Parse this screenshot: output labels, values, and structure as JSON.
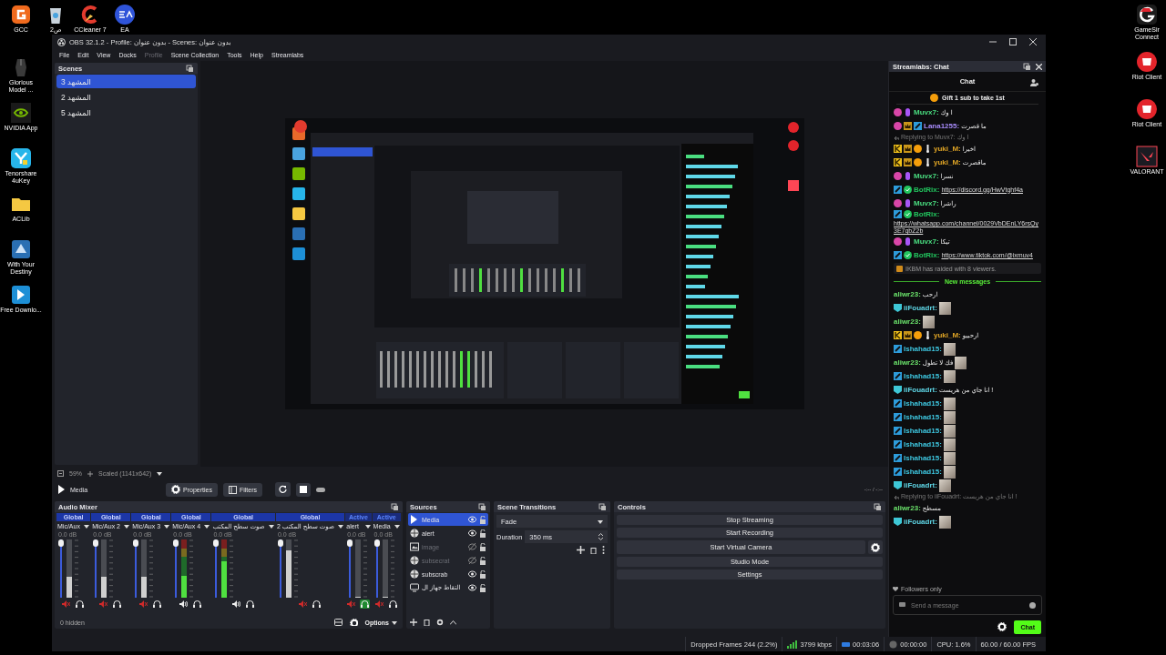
{
  "desktop": {
    "top_row": [
      {
        "label": "GCC",
        "kind": "gcc"
      },
      {
        "label": "2ص",
        "kind": "bin"
      },
      {
        "label": "CCleaner 7",
        "kind": "ccleaner"
      },
      {
        "label": "EA",
        "kind": "ea"
      }
    ],
    "left_column": [
      {
        "label": "Glorious Model ...",
        "kind": "mouse"
      },
      {
        "label": "NVIDIA App",
        "kind": "nvidia"
      },
      {
        "label": "Tenorshare 4uKey",
        "kind": "tenorshare"
      },
      {
        "label": "ACLib",
        "kind": "folder"
      },
      {
        "label": "With Your Destiny",
        "kind": "game"
      },
      {
        "label": "Free Downlo...",
        "kind": "free"
      }
    ],
    "right_column": [
      {
        "label": "GameSir Connect",
        "kind": "gamesir"
      },
      {
        "label": "Riot Client",
        "kind": "riot"
      },
      {
        "label": "Riot Client",
        "kind": "riot"
      },
      {
        "label": "VALORANT",
        "kind": "valorant"
      }
    ]
  },
  "window": {
    "title": "OBS 32.1.2 - Profile: بدون عنوان - Scenes: بدون عنوان",
    "menu": [
      {
        "label": "File",
        "disabled": false
      },
      {
        "label": "Edit",
        "disabled": false
      },
      {
        "label": "View",
        "disabled": false
      },
      {
        "label": "Docks",
        "disabled": false
      },
      {
        "label": "Profile",
        "disabled": true
      },
      {
        "label": "Scene Collection",
        "disabled": false
      },
      {
        "label": "Tools",
        "disabled": false
      },
      {
        "label": "Help",
        "disabled": false
      },
      {
        "label": "Streamlabs",
        "disabled": false
      }
    ]
  },
  "scenes": {
    "title": "Scenes",
    "items": [
      {
        "label": "المشهد 3",
        "selected": true
      },
      {
        "label": "المشهد 2",
        "selected": false
      },
      {
        "label": "المشهد 5",
        "selected": false
      }
    ]
  },
  "preview_toolbar": {
    "zoom": "59%",
    "scale": "Scaled (1141x642)"
  },
  "media_bar": {
    "source": "Media",
    "properties": "Properties",
    "filters": "Filters",
    "time": "-:-- / -:--"
  },
  "audio_mixer": {
    "title": "Audio Mixer",
    "hidden": "0 hidden",
    "options": "Options",
    "channels": [
      {
        "mode": "Global",
        "name": "Mic/Aux",
        "reading": "0.0 dB",
        "fader": {
          "level": 1
        },
        "meter": {
          "level": 0.36
        },
        "muted": true,
        "monitor": false
      },
      {
        "mode": "Global",
        "name": "Mic/Aux 2",
        "reading": "0.0 dB",
        "fader": {
          "level": 1
        },
        "meter": {
          "level": 0.36
        },
        "muted": true,
        "monitor": false
      },
      {
        "mode": "Global",
        "name": "Mic/Aux 3",
        "reading": "0.0 dB",
        "fader": {
          "level": 1
        },
        "meter": {
          "level": 0.36
        },
        "muted": true,
        "monitor": false
      },
      {
        "mode": "Global",
        "name": "Mic/Aux 4",
        "reading": "0.0 dB",
        "fader": {
          "level": 1
        },
        "meter": {
          "level": 0.38
        },
        "muted": false,
        "monitor": false
      },
      {
        "mode": "Global",
        "name": "صوت سطح المكتب",
        "reading": "0.0 dB",
        "fader": {
          "level": 1
        },
        "meter": {
          "level": 0.62
        },
        "muted": false,
        "monitor": false
      },
      {
        "mode": "Global",
        "name": "صوت سطح المكتب 2",
        "reading": "0.0 dB",
        "fader": {
          "level": 1
        },
        "meter": {
          "level": 0.82
        },
        "muted": true,
        "monitor": false
      },
      {
        "mode": "Active",
        "name": "alert",
        "reading": "0.0 dB",
        "fader": {
          "level": 1
        },
        "meter": {
          "level": 0
        },
        "muted": true,
        "monitor": true
      },
      {
        "mode": "Active",
        "name": "Media",
        "reading": "0.0 dB",
        "fader": {
          "level": 1
        },
        "meter": {
          "level": 0
        },
        "muted": true,
        "monitor": false
      }
    ]
  },
  "sources": {
    "title": "Sources",
    "items": [
      {
        "label": "Media",
        "kind": "media",
        "selected": true,
        "visible": true
      },
      {
        "label": "alert",
        "kind": "browser",
        "selected": false,
        "visible": true
      },
      {
        "label": "image",
        "kind": "image",
        "selected": false,
        "visible": false
      },
      {
        "label": "subsecrat",
        "kind": "browser",
        "selected": false,
        "visible": false
      },
      {
        "label": "subscrab",
        "kind": "browser",
        "selected": false,
        "visible": true
      },
      {
        "label": "التقاط جهاز ال",
        "kind": "display",
        "selected": false,
        "visible": true
      }
    ]
  },
  "scene_transitions": {
    "title": "Scene Transitions",
    "transition": "Fade",
    "duration_label": "Duration",
    "duration": "350 ms"
  },
  "controls": {
    "title": "Controls",
    "buttons": [
      {
        "label": "Stop Streaming",
        "kind": "plain"
      },
      {
        "label": "Start Recording",
        "kind": "plain"
      },
      {
        "label": "Start Virtual Camera",
        "kind": "with_settings"
      },
      {
        "label": "Studio Mode",
        "kind": "plain"
      },
      {
        "label": "Settings",
        "kind": "plain"
      }
    ]
  },
  "chat": {
    "dock_title": "Streamlabs: Chat",
    "title": "Chat",
    "pinned": "Gift 1 sub to take 1st",
    "messages": [
      {
        "kind": "message",
        "badges": [
          {
            "kind": "sub"
          },
          {
            "kind": "mic"
          }
        ],
        "user": "Muvx7:",
        "color": "#4ade80",
        "text": "ا وك"
      },
      {
        "kind": "message",
        "badges": [
          {
            "kind": "sub"
          },
          {
            "kind": "crown"
          },
          {
            "kind": "mod"
          }
        ],
        "user": "Lana1255:",
        "color": "#a78bfa",
        "text": "ما قصرت"
      },
      {
        "kind": "reply",
        "text": "Replying to Muvx7: ا وك"
      },
      {
        "kind": "message",
        "badges": [
          {
            "kind": "k"
          },
          {
            "kind": "crown"
          },
          {
            "kind": "coin"
          },
          {
            "kind": "drop"
          }
        ],
        "user": "yuki_M:",
        "color": "#e0a526",
        "text": "اخيرا"
      },
      {
        "kind": "message",
        "badges": [
          {
            "kind": "k"
          },
          {
            "kind": "crown"
          },
          {
            "kind": "coin"
          },
          {
            "kind": "drop"
          }
        ],
        "user": "yuki_M:",
        "color": "#e0a526",
        "text": "ماقصرت"
      },
      {
        "kind": "message",
        "badges": [
          {
            "kind": "sub"
          },
          {
            "kind": "mic"
          }
        ],
        "user": "Muvx7:",
        "color": "#4ade80",
        "text": "نسرا"
      },
      {
        "kind": "message",
        "badges": [
          {
            "kind": "mod"
          },
          {
            "kind": "verified"
          }
        ],
        "user": "BotRix:",
        "color": "#22c55e",
        "text": "https://discord.gg/HwVtghf4a",
        "link": true
      },
      {
        "kind": "message",
        "badges": [
          {
            "kind": "sub"
          },
          {
            "kind": "mic"
          }
        ],
        "user": "Muvx7:",
        "color": "#4ade80",
        "text": "راشرا"
      },
      {
        "kind": "message",
        "badges": [
          {
            "kind": "mod"
          },
          {
            "kind": "verified"
          }
        ],
        "user": "BotRix:",
        "color": "#22c55e",
        "text": "https://whatsapp.com/channel/0029VbDEnLY6rsQy3E7qbZ2b",
        "link": true
      },
      {
        "kind": "message",
        "badges": [
          {
            "kind": "sub"
          },
          {
            "kind": "mic"
          }
        ],
        "user": "Muvx7:",
        "color": "#4ade80",
        "text": "تيكا"
      },
      {
        "kind": "message",
        "badges": [
          {
            "kind": "mod"
          },
          {
            "kind": "verified"
          }
        ],
        "user": "BotRix:",
        "color": "#22c55e",
        "text": "https://www.tiktok.com/@ixmuv4",
        "link": true
      },
      {
        "kind": "raid",
        "text": "IKBM has raided with 8 viewers."
      },
      {
        "kind": "divider",
        "text": "New messages"
      },
      {
        "kind": "message",
        "user": "aliwr23:",
        "color": "#6be36b",
        "text": "ارحب"
      },
      {
        "kind": "message",
        "badges": [
          {
            "kind": "tier"
          }
        ],
        "user": "iiFouadrt:",
        "color": "#5fd8e8",
        "emote": true
      },
      {
        "kind": "message",
        "user": "aliwr23:",
        "color": "#6be36b",
        "emote": true
      },
      {
        "kind": "message",
        "badges": [
          {
            "kind": "k"
          },
          {
            "kind": "crown"
          },
          {
            "kind": "coin"
          },
          {
            "kind": "drop"
          }
        ],
        "user": "yuki_M:",
        "color": "#e0a526",
        "text": "ارحبيو"
      },
      {
        "kind": "message",
        "badges": [
          {
            "kind": "mod"
          }
        ],
        "user": "Ishahad15:",
        "color": "#3ec6df",
        "emote": true
      },
      {
        "kind": "message",
        "user": "aliwr23:",
        "color": "#6be36b",
        "text": "فك لا تطول",
        "emote": true
      },
      {
        "kind": "message",
        "badges": [
          {
            "kind": "mod"
          }
        ],
        "user": "Ishahad15:",
        "color": "#3ec6df",
        "emote": true
      },
      {
        "kind": "message",
        "badges": [
          {
            "kind": "tier"
          }
        ],
        "user": "iiFouadrt:",
        "color": "#5fd8e8",
        "text": "انا جاي من هريست !"
      },
      {
        "kind": "message",
        "badges": [
          {
            "kind": "mod"
          }
        ],
        "user": "Ishahad15:",
        "color": "#3ec6df",
        "emote": true
      },
      {
        "kind": "message",
        "badges": [
          {
            "kind": "mod"
          }
        ],
        "user": "Ishahad15:",
        "color": "#3ec6df",
        "emote": true
      },
      {
        "kind": "message",
        "badges": [
          {
            "kind": "mod"
          }
        ],
        "user": "Ishahad15:",
        "color": "#3ec6df",
        "emote": true
      },
      {
        "kind": "message",
        "badges": [
          {
            "kind": "mod"
          }
        ],
        "user": "Ishahad15:",
        "color": "#3ec6df",
        "emote": true
      },
      {
        "kind": "message",
        "badges": [
          {
            "kind": "mod"
          }
        ],
        "user": "Ishahad15:",
        "color": "#3ec6df",
        "emote": true
      },
      {
        "kind": "message",
        "badges": [
          {
            "kind": "mod"
          }
        ],
        "user": "Ishahad15:",
        "color": "#3ec6df",
        "emote": true
      },
      {
        "kind": "message",
        "badges": [
          {
            "kind": "tier"
          }
        ],
        "user": "iiFouadrt:",
        "color": "#5fd8e8",
        "emote": true
      },
      {
        "kind": "reply",
        "text": "Replying to iiFouadrt: انا جاي من هريست !"
      },
      {
        "kind": "message",
        "user": "aliwr23:",
        "color": "#6be36b",
        "text": "مسطح"
      },
      {
        "kind": "message",
        "badges": [
          {
            "kind": "tier"
          }
        ],
        "user": "iiFouadrt:",
        "color": "#5fd8e8",
        "emote": true
      }
    ],
    "followers": "Followers only",
    "placeholder": "Send a message",
    "send": "Chat"
  },
  "status_bar": {
    "items": [
      {
        "kind": "dropped",
        "text": "Dropped Frames 244 (2.2%)"
      },
      {
        "kind": "bitrate",
        "text": "3799 kbps"
      },
      {
        "kind": "stream_time",
        "text": "00:03:06"
      },
      {
        "kind": "record_time",
        "text": "00:00:00"
      },
      {
        "kind": "cpu",
        "text": "CPU: 1.6%"
      },
      {
        "kind": "fps",
        "text": "60.00 / 60.00 FPS"
      }
    ]
  }
}
